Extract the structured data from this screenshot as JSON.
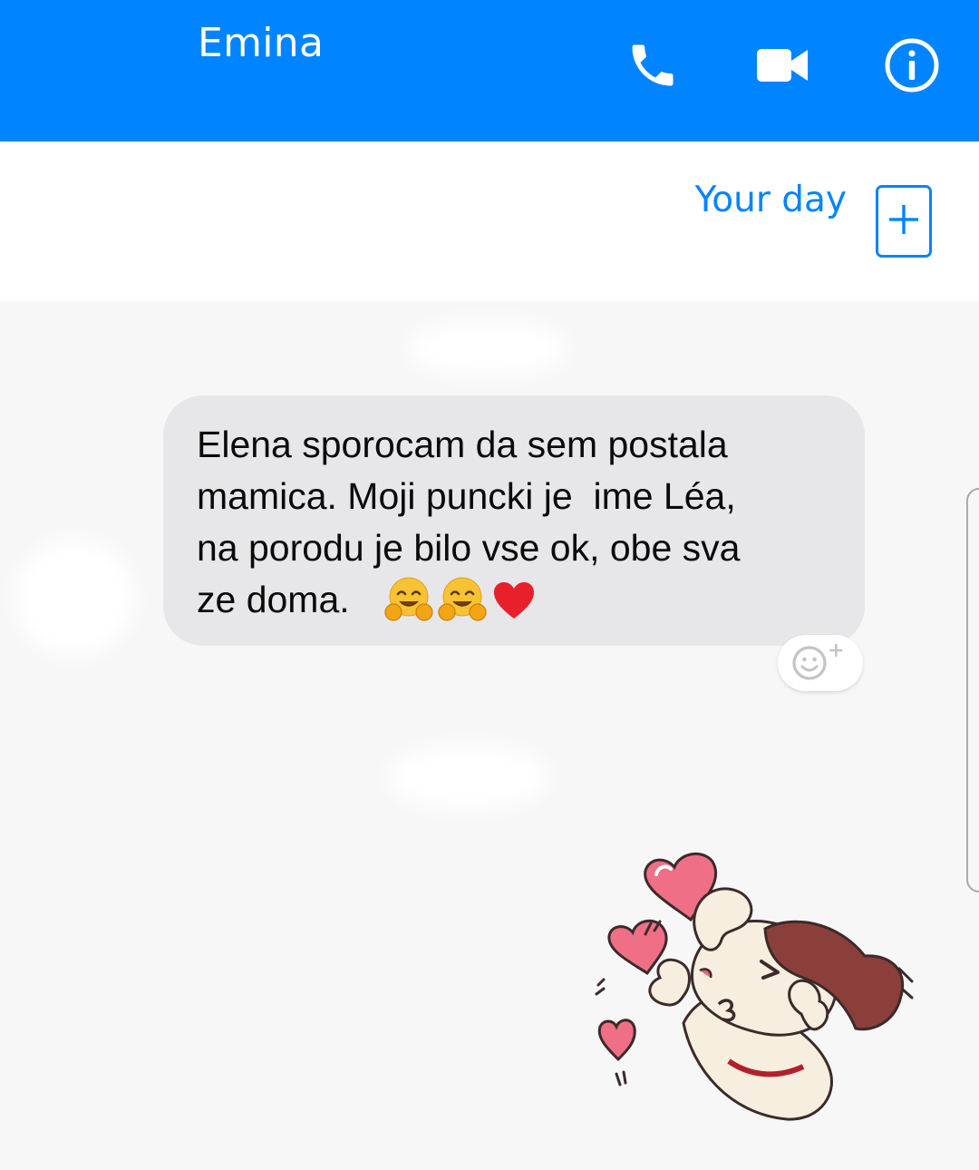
{
  "header": {
    "title": "Emina",
    "background_color": "#0084ff",
    "icons": [
      "phone-icon",
      "video-camera-icon",
      "info-icon"
    ]
  },
  "stories": {
    "your_day_label": "Your day",
    "add_icon": "plus-icon",
    "accent_color": "#0084ff"
  },
  "conversation": {
    "message": {
      "text": "Elena sporocam da sem postala\nmamica. Moji puncki je  ime Léa,\nna porodu je bilo vse ok, obe sva\nze doma.",
      "emojis": [
        "hugging-face-emoji",
        "hugging-face-emoji",
        "red-heart-emoji"
      ],
      "bubble_color": "#e7e7e9"
    },
    "reaction_button_icon": "smiley-add-reaction-icon",
    "sticker": "dog-blowing-kiss-hearts-sticker"
  }
}
